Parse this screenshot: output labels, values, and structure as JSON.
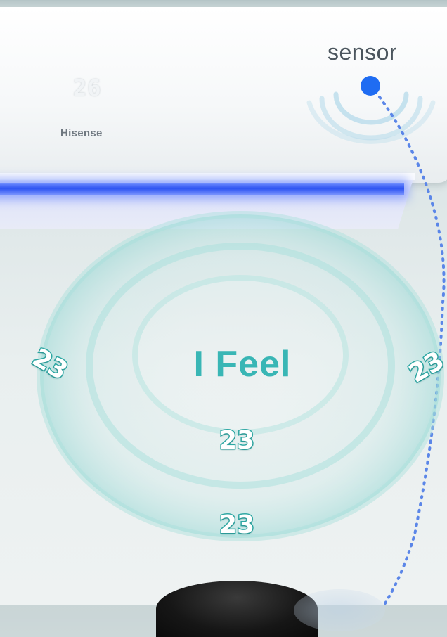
{
  "ac": {
    "display_temp": "26",
    "brand": "Hisense"
  },
  "sensor": {
    "label": "sensor"
  },
  "feature": {
    "title": "I Feel"
  },
  "temperatures": {
    "left": "23",
    "right": "23",
    "center": "23",
    "bottom": "23"
  },
  "colors": {
    "accent_teal": "#39b6b5",
    "sensor_blue": "#1f6cf2",
    "louver_glow": "#2f54f2"
  },
  "icons": [
    "sensor-dot-icon",
    "sensor-signal-icon"
  ]
}
